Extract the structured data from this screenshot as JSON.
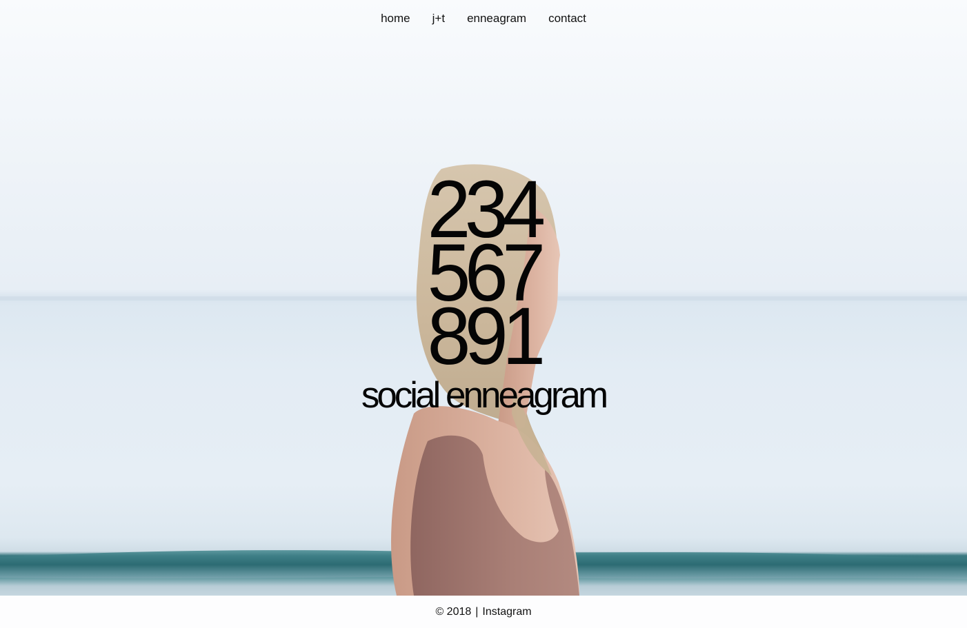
{
  "nav": {
    "items": [
      {
        "label": "home"
      },
      {
        "label": "j+t"
      },
      {
        "label": "enneagram"
      },
      {
        "label": "contact"
      }
    ]
  },
  "hero": {
    "digit_lines": [
      "234",
      "567",
      "891"
    ],
    "subtitle": "social enneagram",
    "background_image": "woman-by-the-sea-photo"
  },
  "footer": {
    "copyright": "© 2018",
    "separator": "|",
    "instagram_label": "Instagram"
  },
  "colors": {
    "text": "#050505",
    "sky": "#eef3f8",
    "wave": "#2f6e76",
    "top_fabric": "#a87b72"
  }
}
